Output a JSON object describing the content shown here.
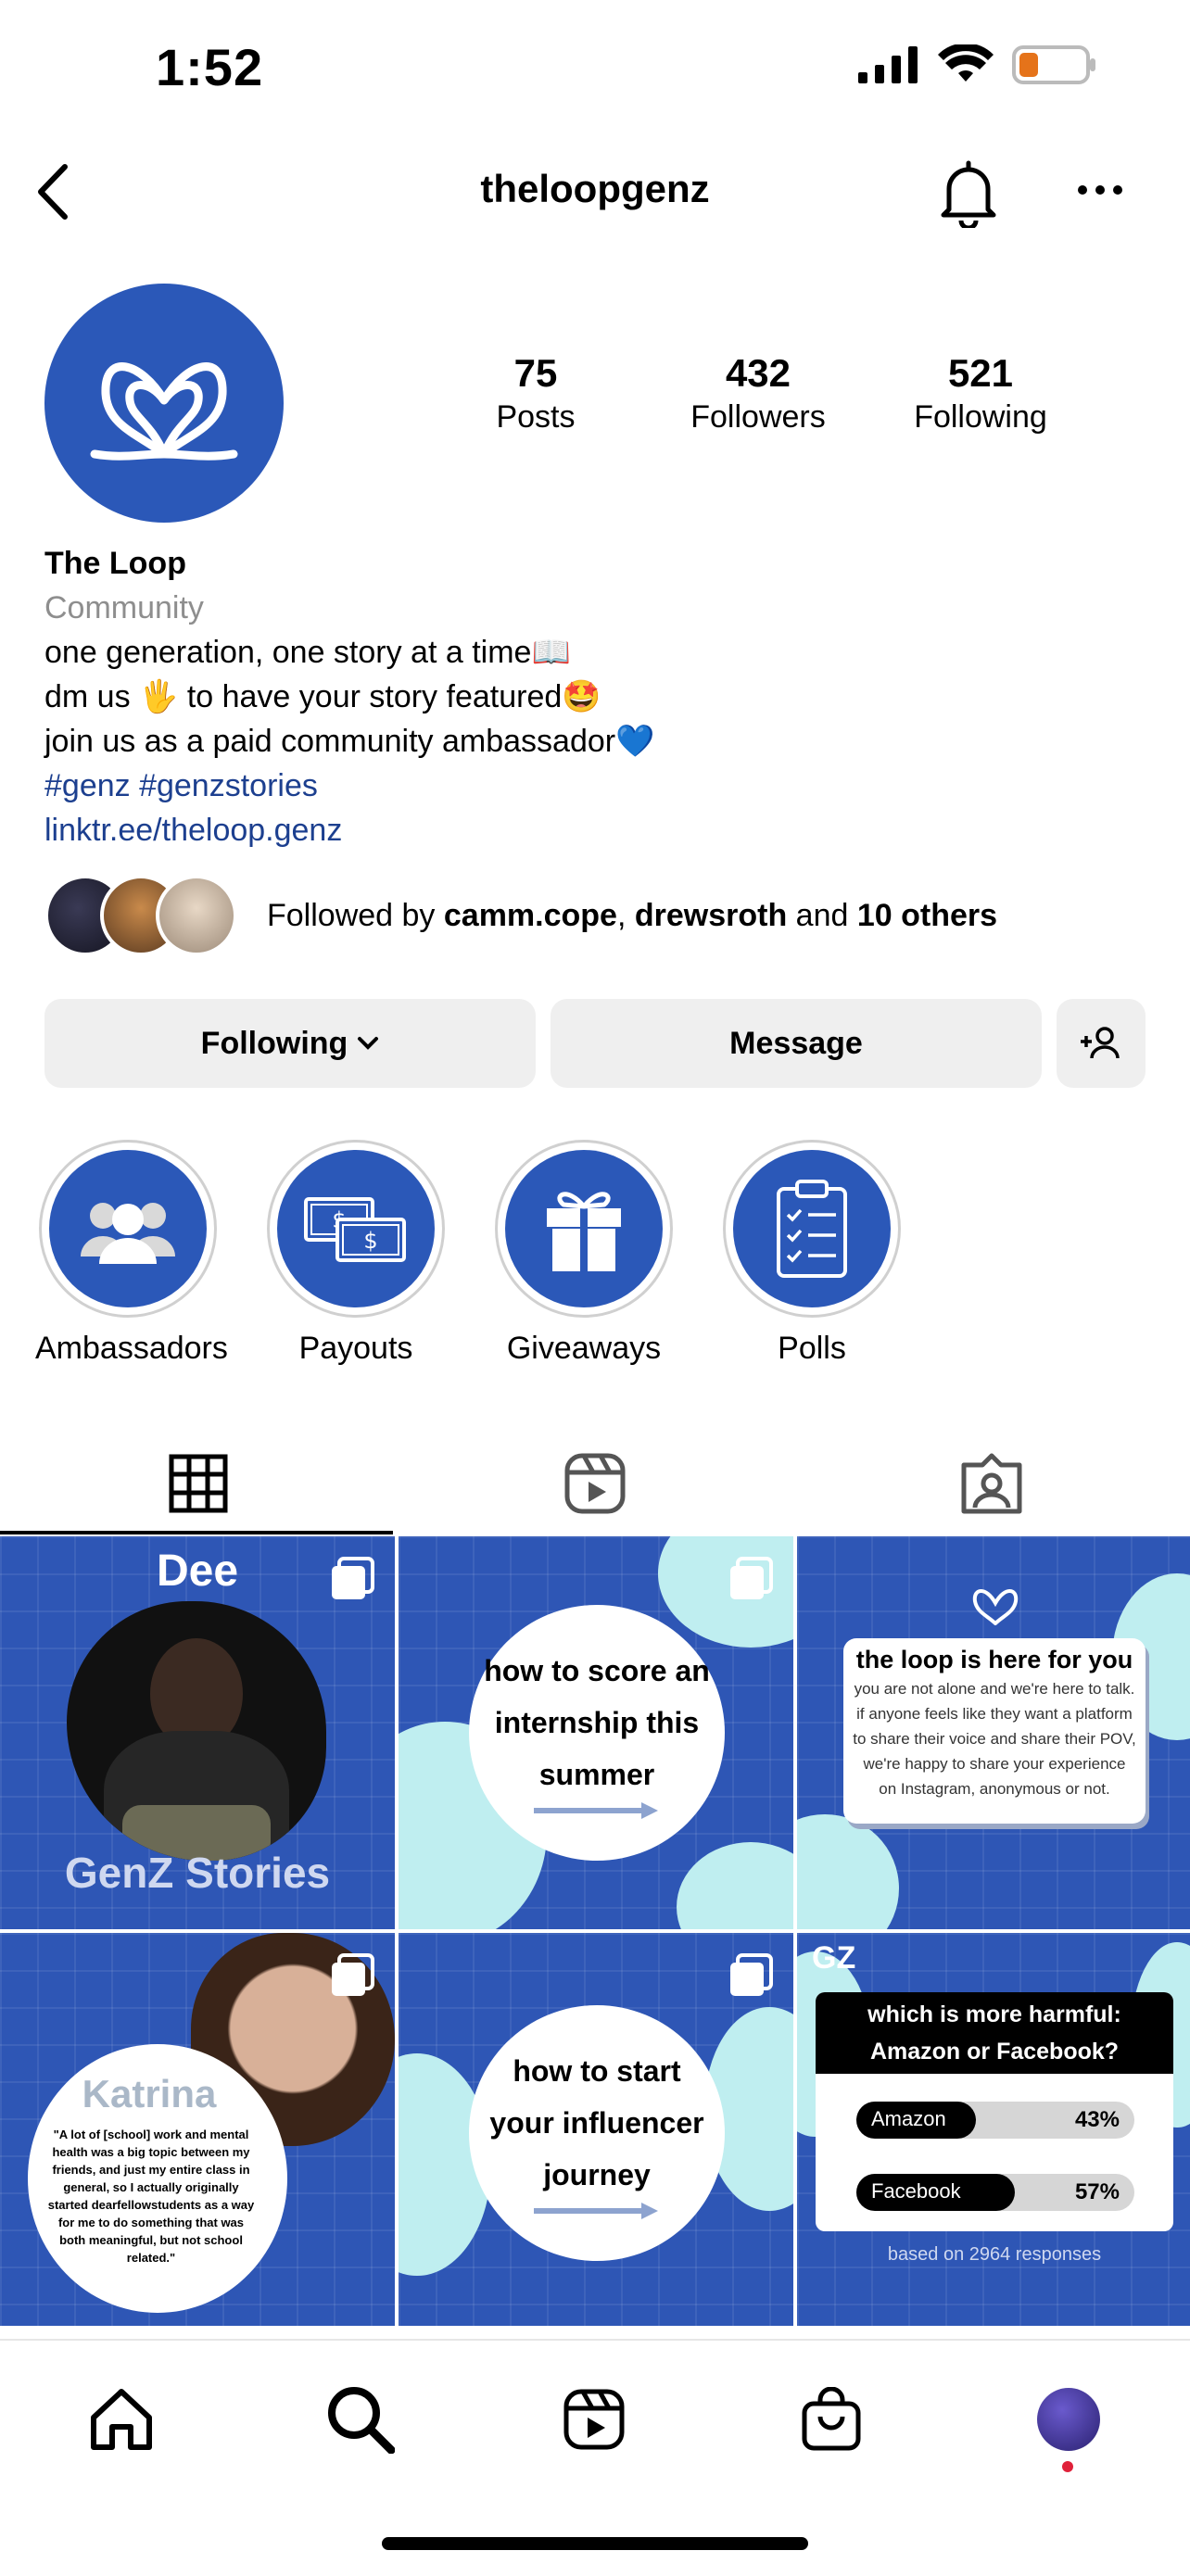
{
  "status_bar": {
    "time": "1:52"
  },
  "header": {
    "username": "theloopgenz"
  },
  "profile": {
    "stats": [
      {
        "value": "75",
        "label": "Posts"
      },
      {
        "value": "432",
        "label": "Followers"
      },
      {
        "value": "521",
        "label": "Following"
      }
    ],
    "name": "The Loop",
    "category": "Community",
    "bio_lines": [
      "one generation, one story at a time📖",
      "dm us 🖐️ to have your story featured🤩",
      "join us as a paid community ambassador💙"
    ],
    "hashtags": "#genz #genzstories",
    "link": "linktr.ee/theloop.genz",
    "followed_by": {
      "prefix": "Followed by ",
      "user1": "camm.cope",
      "sep": ", ",
      "user2": "drewsroth",
      "and": " and ",
      "others": "10 others"
    }
  },
  "actions": {
    "following": "Following",
    "message": "Message"
  },
  "highlights": [
    {
      "label": "Ambassadors",
      "icon": "people-icon"
    },
    {
      "label": "Payouts",
      "icon": "money-icon"
    },
    {
      "label": "Giveaways",
      "icon": "gift-icon"
    },
    {
      "label": "Polls",
      "icon": "clipboard-icon"
    }
  ],
  "tabs": [
    "grid-icon",
    "reels-icon",
    "tagged-icon"
  ],
  "posts": {
    "p1": {
      "top": "Dee",
      "bottom": "GenZ Stories"
    },
    "p2": {
      "line1": "how to score an",
      "line2": "internship this",
      "line3": "summer"
    },
    "p3": {
      "title": "the loop is here for you",
      "body": "you are not alone and we're here to talk. if anyone feels like they want a platform to share their voice and share their POV, we're happy to share your experience on Instagram, anonymous or not."
    },
    "p4": {
      "name": "Katrina",
      "quote": "\"A lot of [school] work and mental health was a big topic between my friends, and just my entire class in general, so I actually originally started dearfellowstudents as a way for me to do something that was both meaningful, but not school related.\""
    },
    "p5": {
      "line1": "how to start",
      "line2": "your influencer",
      "line3": "journey"
    },
    "p6": {
      "logo": "GZ",
      "question": "which is more harmful: Amazon or Facebook?",
      "options": [
        {
          "label": "Amazon",
          "pct": "43%",
          "value": 43
        },
        {
          "label": "Facebook",
          "pct": "57%",
          "value": 57
        }
      ],
      "footer": "based on 2964 responses"
    }
  },
  "colors": {
    "brand_blue": "#2b58b8",
    "link_blue": "#1c3f8f",
    "light_cyan": "#bfeef0"
  }
}
